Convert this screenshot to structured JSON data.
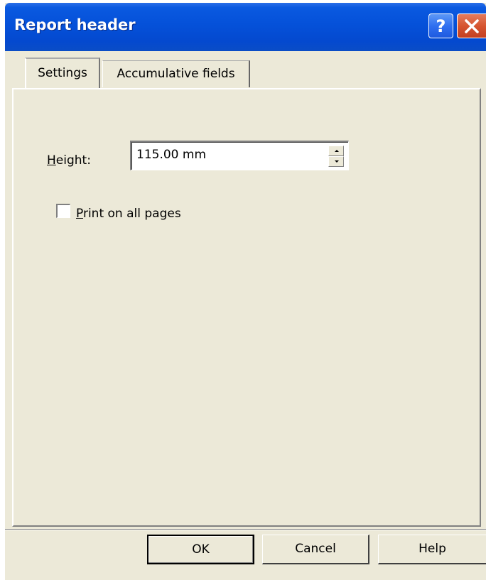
{
  "window": {
    "title": "Report header"
  },
  "title_buttons": {
    "help_glyph": "?",
    "close_glyph": "✕"
  },
  "tabs": [
    {
      "label": "Settings",
      "selected": true
    },
    {
      "label": "Accumulative fields",
      "selected": false
    }
  ],
  "settings": {
    "height_label_mnemonic": "H",
    "height_label_rest": "eight:",
    "height_value": "115.00 mm",
    "print_all_pages": {
      "label_mnemonic": "P",
      "label_rest": "rint on all pages",
      "checked": false
    }
  },
  "buttons": {
    "ok": "OK",
    "cancel": "Cancel",
    "help": "Help"
  },
  "colors": {
    "titlebar": "#0551d9",
    "dialog_face": "#ece9d8",
    "close_button": "#d65530"
  }
}
